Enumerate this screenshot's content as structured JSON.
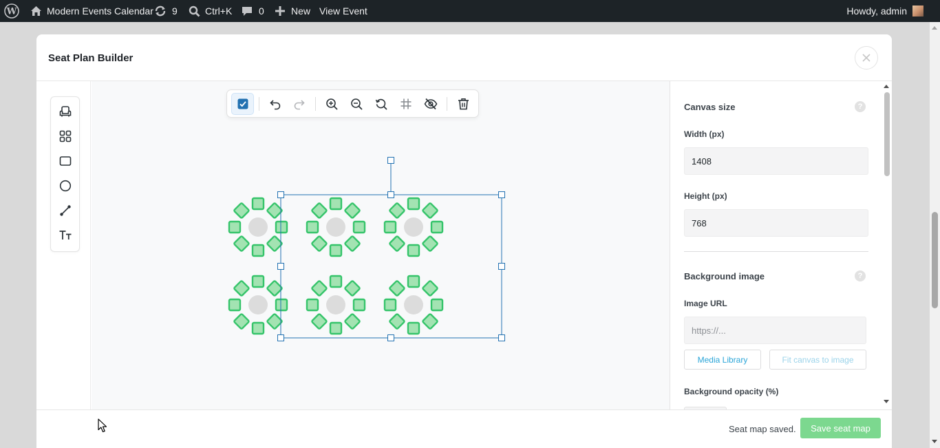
{
  "admin_bar": {
    "site_name": "Modern Events Calendar",
    "updates_count": "9",
    "search_shortcut": "Ctrl+K",
    "comments_count": "0",
    "new_label": "New",
    "view_label": "View Event",
    "greeting": "Howdy, admin"
  },
  "modal": {
    "title": "Seat Plan Builder",
    "tools": [
      "seat-tool",
      "table-tool",
      "rectangle-tool",
      "circle-tool",
      "line-tool",
      "text-tool"
    ],
    "toolbar": [
      "select-checkbox",
      "undo",
      "redo",
      "zoom-in",
      "zoom-out",
      "reset-zoom",
      "grid",
      "hide-labels",
      "delete"
    ]
  },
  "panel": {
    "canvas_size": {
      "title": "Canvas size",
      "help": "?",
      "width_label": "Width (px)",
      "width_value": "1408",
      "height_label": "Height (px)",
      "height_value": "768"
    },
    "background": {
      "title": "Background image",
      "help": "?",
      "url_label": "Image URL",
      "url_placeholder": "https://...",
      "media_library_label": "Media Library",
      "fit_canvas_label": "Fit canvas to image",
      "opacity_label": "Background opacity (%)"
    }
  },
  "footer": {
    "status": "Seat map saved.",
    "save_label": "Save seat map"
  },
  "colors": {
    "seat_fill": "#a3e3b2",
    "seat_stroke": "#35c46a",
    "table_fill": "#dcdcdc",
    "selection": "#2271b1",
    "accent": "#2aa5d8",
    "save_button": "#7cd88f"
  }
}
